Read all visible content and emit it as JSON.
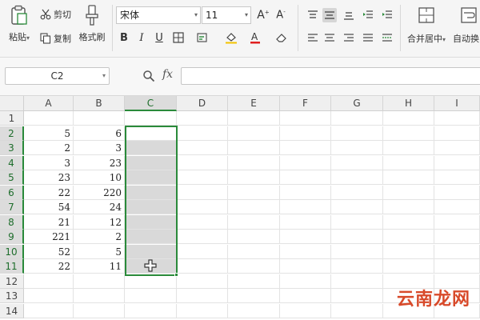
{
  "ribbon": {
    "paste_label": "粘贴",
    "cut_label": "剪切",
    "copy_label": "复制",
    "format_painter_label": "格式刷",
    "font_name": "宋体",
    "font_size": "11",
    "bold": "B",
    "italic": "I",
    "underline": "U",
    "merge_center_label": "合并居中",
    "auto_wrap_label": "自动换"
  },
  "formula_bar": {
    "name_box": "C2",
    "fx_label": "fx",
    "formula_value": ""
  },
  "sheet": {
    "columns": [
      "A",
      "B",
      "C",
      "D",
      "E",
      "F",
      "G",
      "H",
      "I"
    ],
    "rows": [
      "1",
      "2",
      "3",
      "4",
      "5",
      "6",
      "7",
      "8",
      "9",
      "10",
      "11",
      "12",
      "13",
      "14"
    ],
    "selected_column": "C",
    "selected_range": "C2:C11",
    "data": {
      "A": [
        "",
        "5",
        "2",
        "3",
        "23",
        "22",
        "54",
        "21",
        "221",
        "52",
        "22",
        "",
        "",
        ""
      ],
      "B": [
        "",
        "6",
        "3",
        "23",
        "10",
        "220",
        "24",
        "12",
        "2",
        "5",
        "11",
        "",
        "",
        ""
      ]
    }
  },
  "watermark": "云南龙网",
  "colors": {
    "selection": "#2a8a3a",
    "ribbon_bg": "#f5f5f5",
    "watermark": "#d84a2a"
  }
}
